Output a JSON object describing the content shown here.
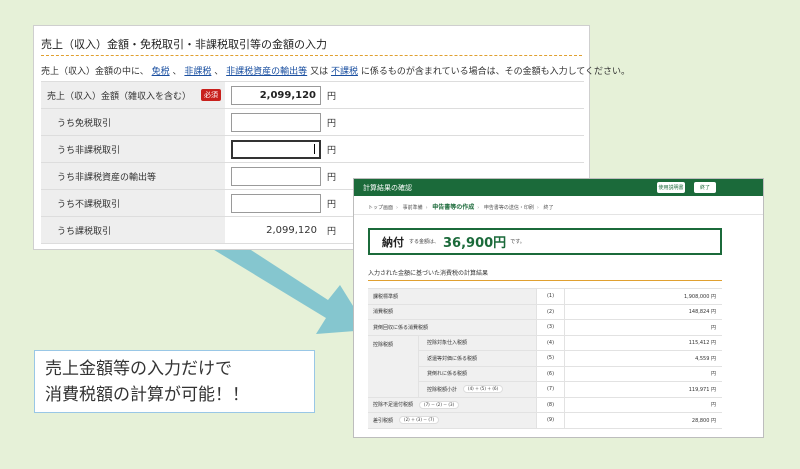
{
  "input_form": {
    "title": "売上（収入）金額・免税取引・非課税取引等の金額の入力",
    "note": {
      "prefix": "売上（収入）金額の中に、",
      "link1": "免税",
      "sep1": "、",
      "link2": "非課税",
      "sep2": "、",
      "link3": "非課税資産の輸出等",
      "mid": "又は",
      "link4": "不課税",
      "suffix": "に係るものが含まれている場合は、その金額も入力してください。"
    },
    "rows": [
      {
        "label": "売上（収入）金額（雑収入を含む）",
        "required": "必須",
        "value": "2,099,120",
        "unit": "円"
      },
      {
        "label": "うち免税取引",
        "value": "",
        "unit": "円"
      },
      {
        "label": "うち非課税取引",
        "value": "",
        "unit": "円"
      },
      {
        "label": "うち非課税資産の輸出等",
        "value": "",
        "unit": "円"
      },
      {
        "label": "うち不課税取引",
        "value": "",
        "unit": "円"
      },
      {
        "label": "うち課税取引",
        "value": "2,099,120",
        "unit": "円"
      }
    ]
  },
  "confirm": {
    "header_title": "計算結果の確認",
    "btn_help": "使用説明書",
    "btn_close": "終了",
    "breadcrumb": [
      "トップ画面",
      "事前準備",
      "申告書等の作成",
      "申告書等の送信・印刷",
      "終了"
    ],
    "result_label": "納付",
    "result_small": "する金額は、",
    "result_amount": "36,900円",
    "result_tail": "です。",
    "section_title": "入力された金額に基づいた消費税の計算結果",
    "rows": [
      {
        "label": "課税標準額",
        "no": "(1)",
        "value": "1,908,000 円"
      },
      {
        "label": "消費税額",
        "no": "(2)",
        "value": "148,824 円"
      },
      {
        "label": "貸倒回収に係る消費税額",
        "no": "(3)",
        "value": "円"
      }
    ],
    "deduction_group": "控除税額",
    "deduction_rows": [
      {
        "label": "控除対象仕入税額",
        "no": "(4)",
        "value": "115,412 円"
      },
      {
        "label": "返還等対価に係る税額",
        "no": "(5)",
        "value": "4,559 円"
      },
      {
        "label": "貸倒れに係る税額",
        "no": "(6)",
        "value": "円"
      },
      {
        "label": "控除税額小計",
        "formula": "(4) ＋ (5) ＋ (6)",
        "no": "(7)",
        "value": "119,971 円"
      }
    ],
    "bottom_rows": [
      {
        "label": "控除不足還付税額",
        "formula": "(7) － (2) － (3)",
        "no": "(8)",
        "value": "円"
      },
      {
        "label": "差引税額",
        "formula": "(2) ＋ (3) － (7)",
        "no": "(9)",
        "value": "28,800 円"
      }
    ]
  },
  "caption": {
    "line1": "売上金額等の入力だけで",
    "line2": "消費税額の計算が可能！！"
  },
  "colors": {
    "background": "#e6f1d8",
    "header_green": "#1b6a3a",
    "arrow": "#7fc3cf",
    "required_red": "#c8201c",
    "link_blue": "#1a4fa0"
  }
}
